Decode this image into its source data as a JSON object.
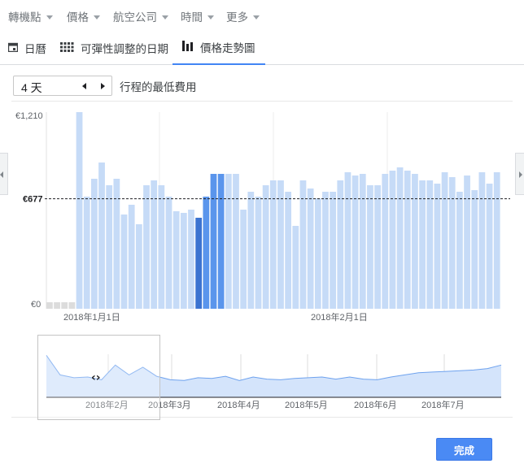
{
  "filters": [
    {
      "label": "轉機點"
    },
    {
      "label": "價格"
    },
    {
      "label": "航空公司"
    },
    {
      "label": "時間"
    },
    {
      "label": "更多"
    }
  ],
  "tabs": [
    {
      "label": "日曆",
      "icon": "calendar-icon"
    },
    {
      "label": "可彈性調整的日期",
      "icon": "grid-icon"
    },
    {
      "label": "價格走勢圖",
      "icon": "bar-chart-icon",
      "active": true
    }
  ],
  "duration": {
    "value": "4 天"
  },
  "lowest_price_label": "行程的最低費用",
  "done_label": "完成",
  "colors": {
    "bar": "#c6dbf7",
    "bar_selected": "#5a95ec",
    "bar_selected_dark": "#3b73d1",
    "bar_empty": "#dcdcdc",
    "area": "#d4e4fb",
    "area_line": "#6ea2ee",
    "accent": "#4a8af4"
  },
  "chart_data": {
    "type": "bar",
    "currency": "€",
    "y_tick_labels": [
      "€1,210",
      "€677",
      "€0"
    ],
    "reference_line": {
      "value": 677,
      "label": "€677"
    },
    "ylim": [
      0,
      1210
    ],
    "x_tick_labels": [
      "2018年1月1日",
      "2018年2月1日"
    ],
    "values": [
      null,
      null,
      null,
      null,
      1210,
      690,
      800,
      900,
      760,
      800,
      580,
      640,
      520,
      760,
      790,
      760,
      690,
      600,
      590,
      610,
      560,
      690,
      830,
      830,
      830,
      830,
      610,
      720,
      690,
      760,
      790,
      790,
      720,
      510,
      790,
      740,
      680,
      720,
      720,
      790,
      840,
      820,
      830,
      760,
      760,
      830,
      850,
      870,
      850,
      830,
      790,
      790,
      770,
      840,
      810,
      720,
      820,
      730,
      840,
      770,
      840
    ],
    "selected_range": [
      20,
      23
    ],
    "selected_dark_index": 20,
    "overview": {
      "type": "area",
      "x_tick_labels": [
        "2018年2月",
        "2018年3月",
        "2018年4月",
        "2018年5月",
        "2018年6月",
        "2018年7月"
      ],
      "values": [
        1000,
        720,
        680,
        690,
        650,
        860,
        720,
        830,
        700,
        650,
        640,
        680,
        670,
        700,
        640,
        690,
        660,
        650,
        670,
        680,
        690,
        660,
        690,
        660,
        650,
        690,
        720,
        750,
        760,
        770,
        780,
        790,
        810,
        860
      ]
    }
  }
}
